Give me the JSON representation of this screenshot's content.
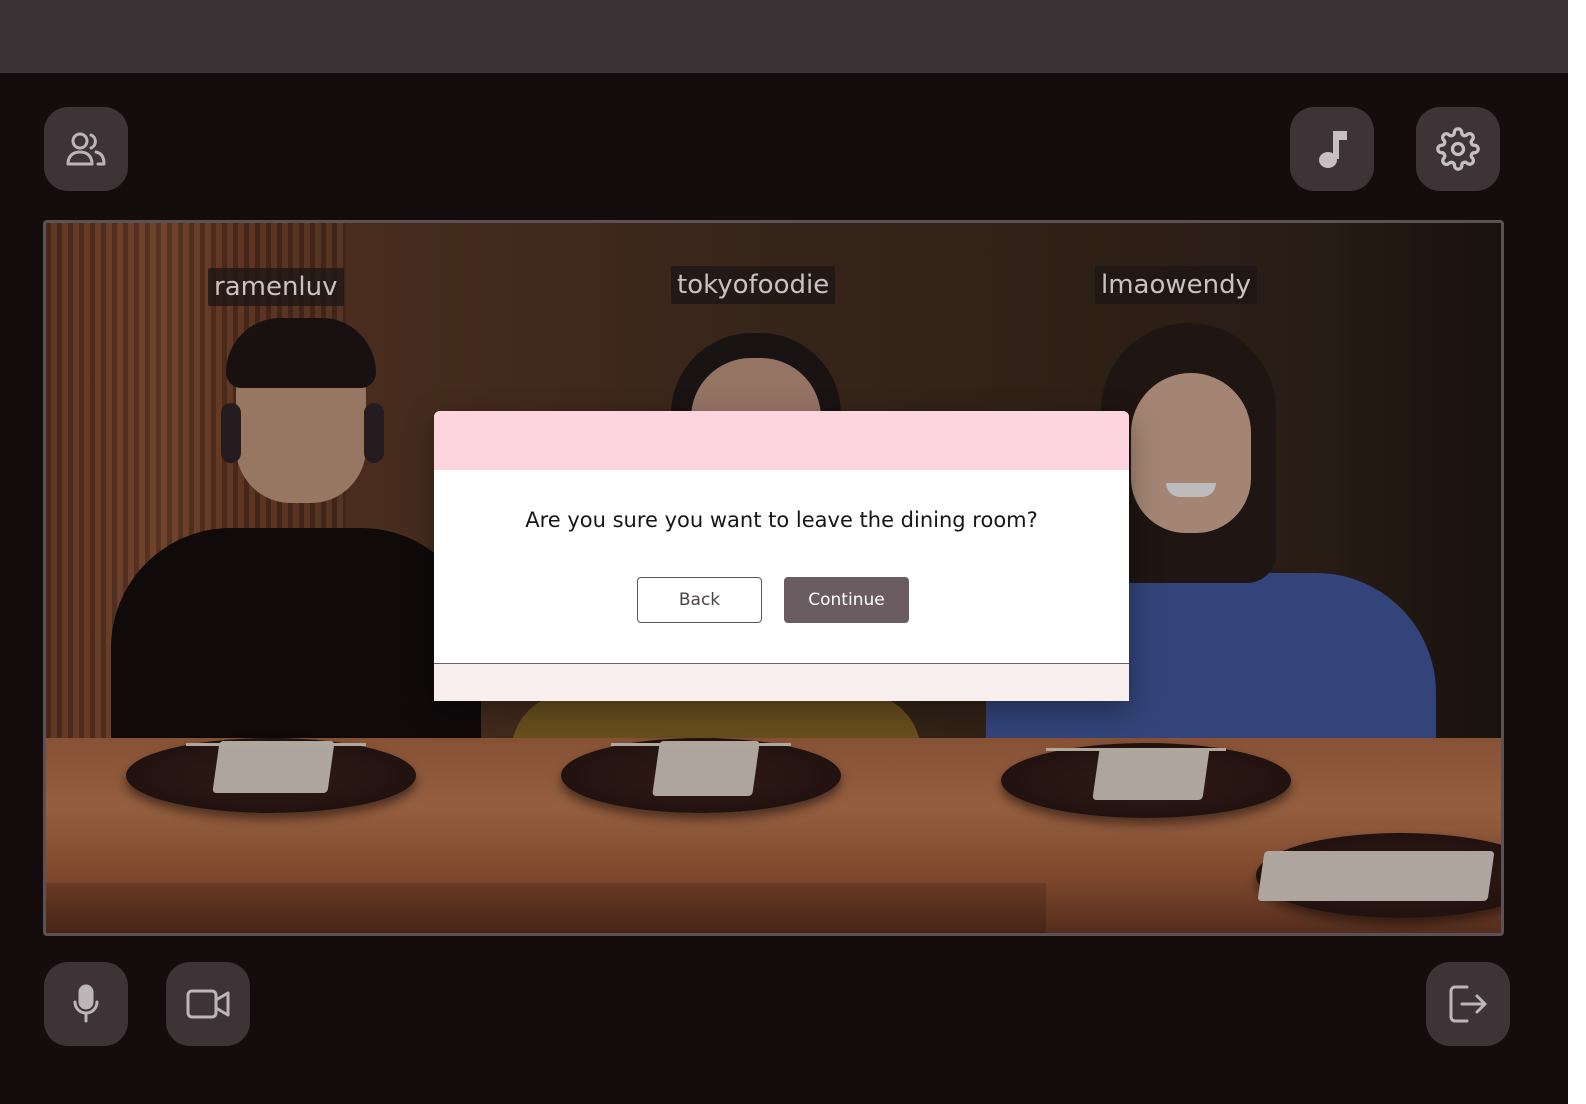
{
  "toolbar": {
    "participants_icon": "users-icon",
    "music_icon": "music-note-icon",
    "settings_icon": "gear-icon"
  },
  "participants": [
    {
      "name": "ramenluv"
    },
    {
      "name": "tokyofoodie"
    },
    {
      "name": "lmaowendy"
    }
  ],
  "dialog": {
    "message": "Are you sure you want to leave the dining room?",
    "back_label": "Back",
    "continue_label": "Continue"
  },
  "controls": {
    "mic_icon": "microphone-icon",
    "camera_icon": "video-camera-icon",
    "leave_icon": "exit-icon"
  },
  "colors": {
    "dialog_header": "#fdd5de",
    "continue_button": "#6b5c62",
    "app_background": "#140c0d",
    "control_button": "#3e3438"
  }
}
